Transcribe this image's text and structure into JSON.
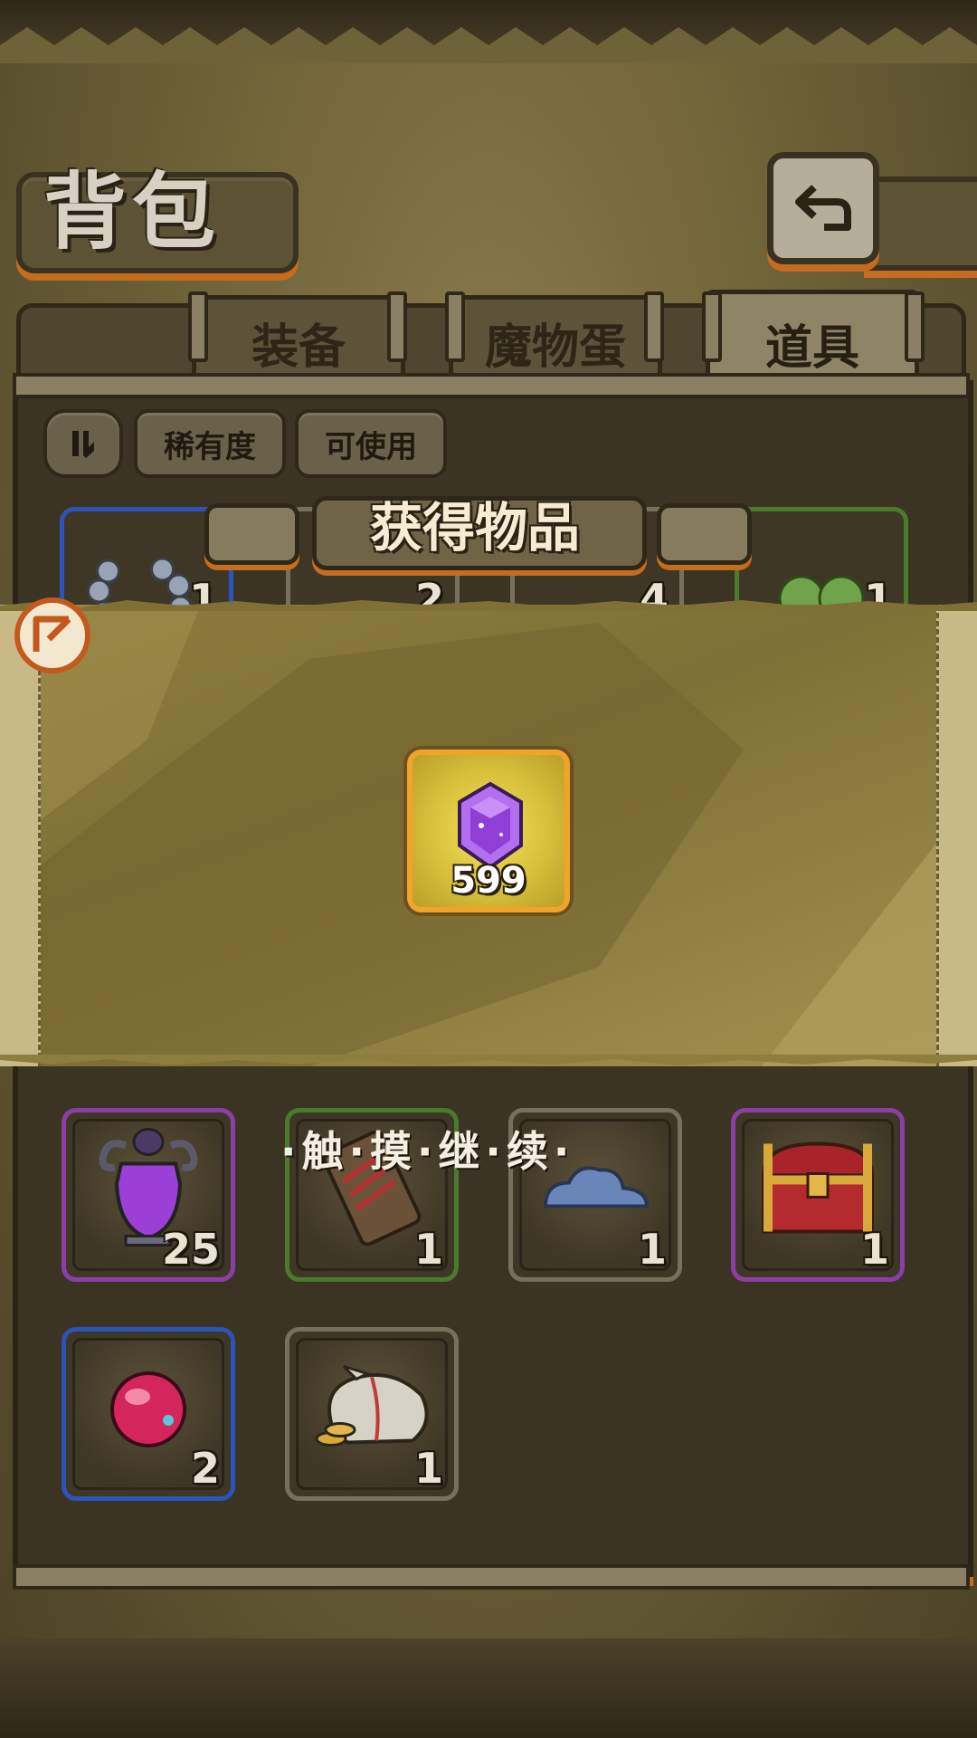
{
  "header": {
    "title": "背包"
  },
  "tabs": [
    {
      "label": "装备",
      "active": false
    },
    {
      "label": "魔物蛋",
      "active": false
    },
    {
      "label": "道具",
      "active": true
    }
  ],
  "filters": {
    "sort_icon": "sort-icon",
    "rarity_label": "稀有度",
    "usable_label": "可使用"
  },
  "popup": {
    "title": "获得物品",
    "reward": {
      "icon": "purple-gem-icon",
      "count": "599"
    },
    "hint": "·触·摸·继·续·"
  },
  "peek_items": [
    {
      "icon": "bead-necklace-icon",
      "count": "1"
    },
    {
      "icon": "white-item-icon",
      "count": "2"
    },
    {
      "icon": "feather-icon",
      "count": "4"
    },
    {
      "icon": "clover-icon",
      "count": "1"
    }
  ],
  "items": [
    {
      "icon": "purple-vase-icon",
      "count": "25",
      "rarity": "purple"
    },
    {
      "icon": "wooden-tag-icon",
      "count": "1",
      "rarity": "green"
    },
    {
      "icon": "blue-cloud-icon",
      "count": "1",
      "rarity": "grey"
    },
    {
      "icon": "treasure-chest-icon",
      "count": "1",
      "rarity": "purple"
    },
    {
      "icon": "pink-orb-icon",
      "count": "2",
      "rarity": "blue"
    },
    {
      "icon": "coin-sack-icon",
      "count": "1",
      "rarity": "grey"
    }
  ],
  "colors": {
    "accent_orange": "#c56c1f",
    "gold_frame": "#f0a42a",
    "purple": "#8b3fa6",
    "blue": "#2e53b8",
    "green": "#4b7a2d"
  }
}
